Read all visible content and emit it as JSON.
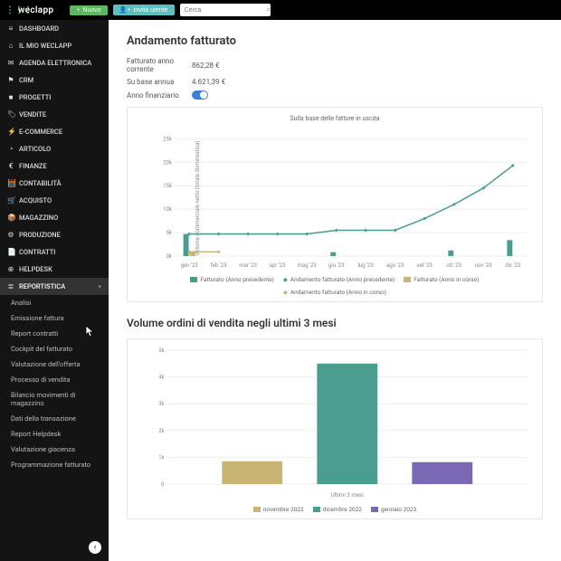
{
  "topbar": {
    "logo_text": "weclapp",
    "new_btn": "Nuovo",
    "invite_btn": "Invita utente",
    "search_placeholder": "Cerca"
  },
  "sidebar": {
    "items": [
      {
        "label": "DASHBOARD",
        "icon": "≡"
      },
      {
        "label": "IL MIO WECLAPP",
        "icon": "⌂"
      },
      {
        "label": "AGENDA ELETTRONICA",
        "icon": "✉"
      },
      {
        "label": "CRM",
        "icon": "⚑"
      },
      {
        "label": "PROGETTI",
        "icon": "■"
      },
      {
        "label": "VENDITE",
        "icon": "🏷"
      },
      {
        "label": "E-COMMERCE",
        "icon": "⚡"
      },
      {
        "label": "ARTICOLO",
        "icon": "◔"
      },
      {
        "label": "FINANZE",
        "icon": "€"
      },
      {
        "label": "CONTABILITÀ",
        "icon": "🧮"
      },
      {
        "label": "ACQUISTO",
        "icon": "🛒"
      },
      {
        "label": "MAGAZZINO",
        "icon": "📦"
      },
      {
        "label": "PRODUZIONE",
        "icon": "⚙"
      },
      {
        "label": "CONTRATTI",
        "icon": "📄"
      },
      {
        "label": "HELPDESK",
        "icon": "⊕"
      },
      {
        "label": "REPORTISTICA",
        "icon": "≣",
        "active": true
      }
    ],
    "subitems": [
      "Analisi",
      "Emissione fattura",
      "Report contratti",
      "Cockpit del fatturato",
      "Valutazione dell'offerta",
      "Processo di vendita",
      "Bilancio movimenti di magazzino",
      "Dati della transazione",
      "Report Helpdesk",
      "Valutazione giacenza",
      "Programmazione fatturato"
    ]
  },
  "revenue": {
    "title": "Andamento fatturato",
    "rows": {
      "current_label": "Fatturato anno corrente",
      "current_value": "862,28 €",
      "annual_label": "Su base annua",
      "annual_value": "4.621,39 €",
      "fy_label": "Anno finanziario"
    }
  },
  "chart_data": [
    {
      "type": "bar+line",
      "title": "Sulla base delle fatture in uscita",
      "ylabel": "Volume commerciale netto (totale dominestica)",
      "categories": [
        "gen '23",
        "feb '23",
        "mar '23",
        "apr '23",
        "mag '23",
        "giu '23",
        "lug '23",
        "ago '23",
        "set '23",
        "ott '23",
        "nov '23",
        "dic '23"
      ],
      "series": [
        {
          "name": "Fatturato (Anno precedente)",
          "kind": "bar",
          "color": "#4a9e8f",
          "values": [
            4700,
            0,
            0,
            0,
            0,
            830,
            0,
            0,
            0,
            1200,
            0,
            3400
          ]
        },
        {
          "name": "Andamento fatturato (Anno precedente)",
          "kind": "line",
          "color": "#4a9e8f",
          "values": [
            4700,
            4700,
            4700,
            4700,
            4700,
            5500,
            5500,
            5500,
            8000,
            11000,
            14500,
            19300
          ]
        },
        {
          "name": "Fatturato (Anno in corso)",
          "kind": "bar",
          "color": "#c9b573",
          "values": [
            900,
            0,
            0,
            0,
            0,
            0,
            0,
            0,
            0,
            0,
            0,
            0
          ]
        },
        {
          "name": "Andamento fatturato (Anno in corso)",
          "kind": "line",
          "color": "#c9b573",
          "values": [
            900,
            900,
            null,
            null,
            null,
            null,
            null,
            null,
            null,
            null,
            null,
            null
          ]
        }
      ],
      "ylim": [
        0,
        27000
      ],
      "yticks": [
        0,
        5000,
        10000,
        15000,
        20000,
        25000
      ],
      "ytick_labels": [
        "0k",
        "5k",
        "10k",
        "15k",
        "20k",
        "25k"
      ]
    },
    {
      "type": "bar",
      "title": "Volume ordini di vendita negli ultimi 3 mesi",
      "xlabel": "Ultimi 3 mesi",
      "categories": [
        "novembre 2022",
        "dicembre 2022",
        "gennaio 2023"
      ],
      "values": [
        850,
        4500,
        820
      ],
      "colors": [
        "#c9b573",
        "#4a9e8f",
        "#7a68b5"
      ],
      "ylim": [
        0,
        5000
      ],
      "yticks": [
        0,
        1000,
        2000,
        3000,
        4000,
        5000
      ],
      "ytick_labels": [
        "0",
        "1k",
        "2k",
        "3k",
        "4k",
        "5k"
      ]
    }
  ],
  "orders": {
    "title": "Volume ordini di vendita negli ultimi 3 mesi"
  },
  "legend2": [
    "novembre 2022",
    "dicembre 2022",
    "gennaio 2023"
  ]
}
